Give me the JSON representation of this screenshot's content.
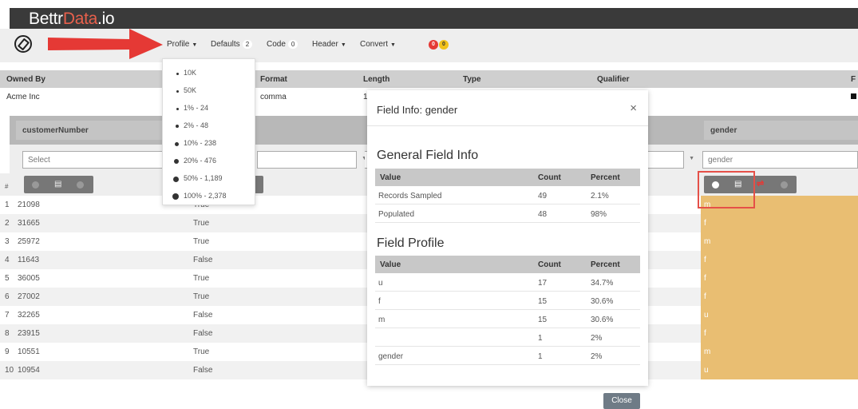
{
  "brand": {
    "part1": "Bettr",
    "part2": "Data",
    "part3": ".io"
  },
  "colors": {
    "brand_accent": "#e8604c",
    "highlight": "#e9be72",
    "arrow": "#e53935",
    "titlebar": "#3a3a3a"
  },
  "toolbar": {
    "profile_label": "Profile",
    "defaults_label": "Defaults",
    "defaults_count": "2",
    "code_label": "Code",
    "code_count": "0",
    "header_label": "Header",
    "convert_label": "Convert",
    "badge_red": "0",
    "badge_yellow": "0"
  },
  "profile_menu": [
    "10K",
    "50K",
    "1% - 24",
    "2% - 48",
    "10% - 238",
    "20% - 476",
    "50% - 1,189",
    "100% - 2,378"
  ],
  "file_header": {
    "columns": [
      "Owned By",
      "Format",
      "Length",
      "Type",
      "Qualifier",
      "F"
    ],
    "values": {
      "owned_by": "Acme Inc",
      "format": "comma",
      "length": "1"
    }
  },
  "grid": {
    "col1_header": "customerNumber",
    "col_gender_header": "gender",
    "select_placeholder": "Select",
    "gender_select_value": "gender",
    "rows": [
      {
        "num": "1",
        "id": "21098",
        "flag": "True",
        "gender": "m"
      },
      {
        "num": "2",
        "id": "31665",
        "flag": "True",
        "gender": "f"
      },
      {
        "num": "3",
        "id": "25972",
        "flag": "True",
        "gender": "m"
      },
      {
        "num": "4",
        "id": "11643",
        "flag": "False",
        "gender": "f"
      },
      {
        "num": "5",
        "id": "36005",
        "flag": "True",
        "gender": "f"
      },
      {
        "num": "6",
        "id": "27002",
        "flag": "True",
        "gender": "f"
      },
      {
        "num": "7",
        "id": "32265",
        "flag": "False",
        "gender": "u"
      },
      {
        "num": "8",
        "id": "23915",
        "flag": "False",
        "gender": "f"
      },
      {
        "num": "9",
        "id": "10551",
        "flag": "True",
        "gender": "m"
      },
      {
        "num": "10",
        "id": "10954",
        "flag": "False",
        "gender": "u"
      }
    ]
  },
  "modal": {
    "title": "Field Info: gender",
    "close_icon": "×",
    "general_title": "General Field Info",
    "general_headers": [
      "Value",
      "Count",
      "Percent"
    ],
    "general_rows": [
      {
        "value": "Records Sampled",
        "count": "49",
        "percent": "2.1%"
      },
      {
        "value": "Populated",
        "count": "48",
        "percent": "98%"
      }
    ],
    "profile_title": "Field Profile",
    "profile_headers": [
      "Value",
      "Count",
      "Percent"
    ],
    "profile_rows": [
      {
        "value": "u",
        "count": "17",
        "percent": "34.7%"
      },
      {
        "value": "f",
        "count": "15",
        "percent": "30.6%"
      },
      {
        "value": "m",
        "count": "15",
        "percent": "30.6%"
      },
      {
        "value": "",
        "count": "1",
        "percent": "2%"
      },
      {
        "value": "gender",
        "count": "1",
        "percent": "2%"
      }
    ],
    "close_button": "Close"
  }
}
